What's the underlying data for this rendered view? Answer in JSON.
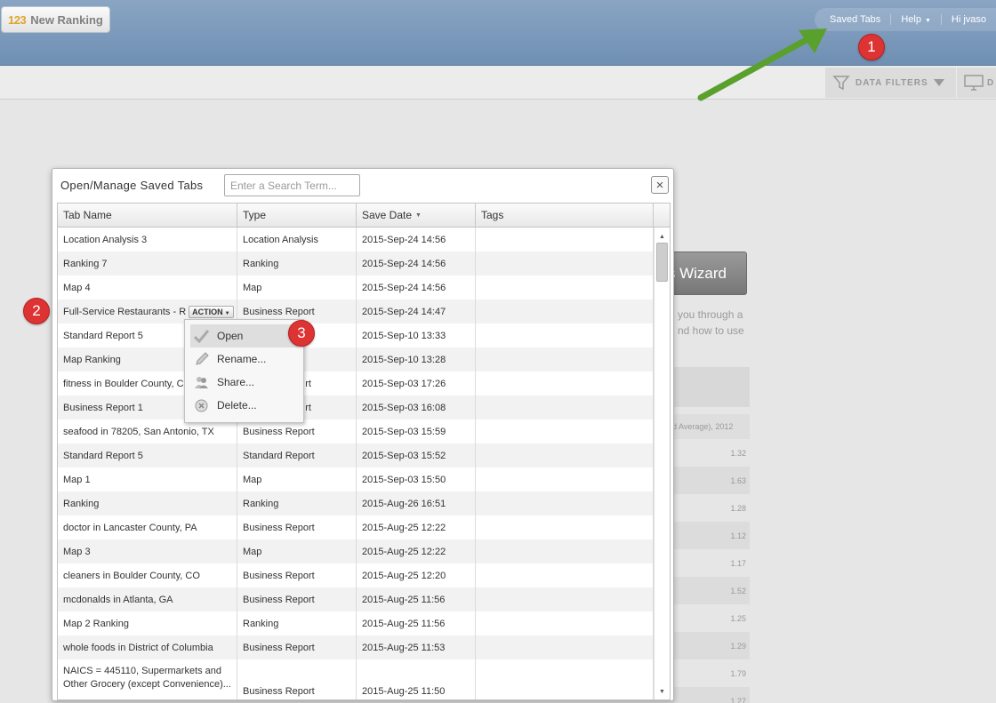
{
  "header": {
    "brand_number": "123",
    "brand_title": "New Ranking",
    "nav": [
      {
        "label": "Saved Tabs"
      },
      {
        "label": "Help"
      },
      {
        "label": "Hi jvaso"
      }
    ]
  },
  "toolbar": {
    "filters_label": "DATA FILTERS",
    "display_label": "D"
  },
  "background": {
    "wizard_label": "s Wizard",
    "text_line1": "you through a",
    "text_line2": "nd how to use",
    "col_header": "old Average), 2012",
    "values": [
      "1.32",
      "1.63",
      "1.28",
      "1.12",
      "1.17",
      "1.52",
      "1.25",
      "1.29",
      "1.79",
      "1.27"
    ]
  },
  "dialog": {
    "title": "Open/Manage Saved Tabs",
    "search_placeholder": "Enter a Search Term...",
    "close_symbol": "×",
    "columns": {
      "tab_name": "Tab Name",
      "type": "Type",
      "save_date": "Save Date",
      "tags": "Tags"
    },
    "rows": [
      {
        "name": "Location Analysis 3",
        "type": "Location Analysis",
        "date": "2015-Sep-24 14:56",
        "tags": ""
      },
      {
        "name": "Ranking 7",
        "type": "Ranking",
        "date": "2015-Sep-24 14:56",
        "tags": ""
      },
      {
        "name": "Map 4",
        "type": "Map",
        "date": "2015-Sep-24 14:56",
        "tags": ""
      },
      {
        "name": "Full-Service Restaurants - R",
        "type": "Business Report",
        "date": "2015-Sep-24 14:47",
        "tags": ""
      },
      {
        "name": "Standard Report 5",
        "type": "",
        "date": "2015-Sep-10 13:33",
        "tags": ""
      },
      {
        "name": "Map Ranking",
        "type": "",
        "date": "2015-Sep-10 13:28",
        "tags": ""
      },
      {
        "name": "fitness in Boulder County, CO",
        "type": "rt",
        "date": "2015-Sep-03 17:26",
        "tags": ""
      },
      {
        "name": "Business Report 1",
        "type": "rt",
        "date": "2015-Sep-03 16:08",
        "tags": ""
      },
      {
        "name": "seafood in 78205, San Antonio, TX",
        "type": "Business Report",
        "date": "2015-Sep-03 15:59",
        "tags": ""
      },
      {
        "name": "Standard Report 5",
        "type": "Standard Report",
        "date": "2015-Sep-03 15:52",
        "tags": ""
      },
      {
        "name": "Map 1",
        "type": "Map",
        "date": "2015-Sep-03 15:50",
        "tags": ""
      },
      {
        "name": "Ranking",
        "type": "Ranking",
        "date": "2015-Aug-26 16:51",
        "tags": ""
      },
      {
        "name": "doctor in Lancaster County, PA",
        "type": "Business Report",
        "date": "2015-Aug-25 12:22",
        "tags": ""
      },
      {
        "name": "Map 3",
        "type": "Map",
        "date": "2015-Aug-25 12:22",
        "tags": ""
      },
      {
        "name": "cleaners in Boulder County, CO",
        "type": "Business Report",
        "date": "2015-Aug-25 12:20",
        "tags": ""
      },
      {
        "name": "mcdonalds in Atlanta, GA",
        "type": "Business Report",
        "date": "2015-Aug-25 11:56",
        "tags": ""
      },
      {
        "name": "Map 2 Ranking",
        "type": "Ranking",
        "date": "2015-Aug-25 11:56",
        "tags": ""
      },
      {
        "name": "whole foods in District of Columbia",
        "type": "Business Report",
        "date": "2015-Aug-25 11:53",
        "tags": ""
      },
      {
        "name": "NAICS = 445110, Supermarkets and Other Grocery (except Convenience)...",
        "type": "Business Report",
        "date": "2015-Aug-25 11:50",
        "tags": ""
      }
    ],
    "action_label": "ACTION"
  },
  "context_menu": {
    "items": [
      {
        "label": "Open",
        "icon": "check-icon"
      },
      {
        "label": "Rename...",
        "icon": "pencil-icon"
      },
      {
        "label": "Share...",
        "icon": "people-icon"
      },
      {
        "label": "Delete...",
        "icon": "delete-circle-icon"
      }
    ]
  },
  "annotations": {
    "badge1": "1",
    "badge2": "2",
    "badge3": "3",
    "arrow_color": "#5aa02c",
    "badge_color": "#dd3333"
  }
}
